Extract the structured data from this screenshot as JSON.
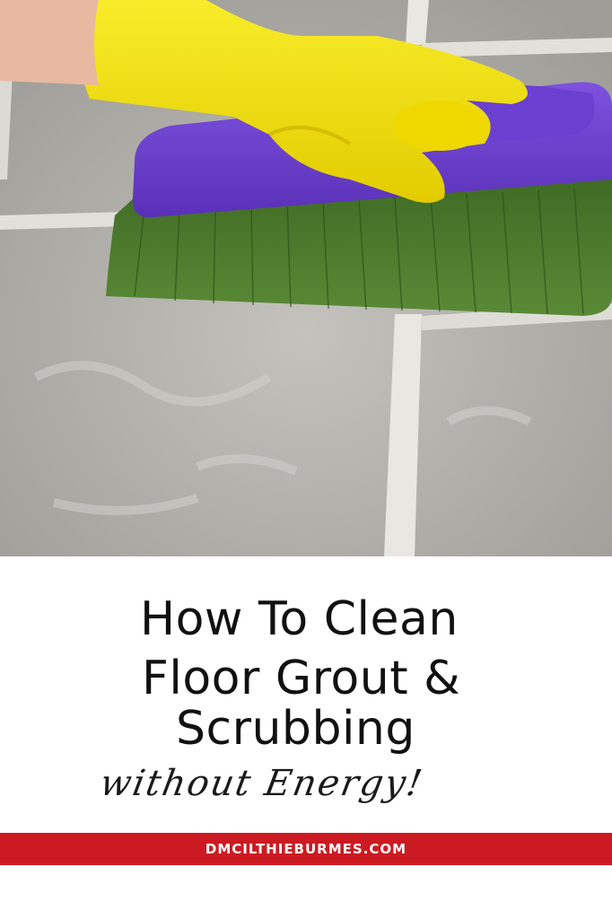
{
  "title": {
    "line1": "How To Clean",
    "line2": "Floor Grout &",
    "line3": "Scrubbing",
    "tagline": "without Energy!"
  },
  "footer": {
    "website": "DMCILTHIEBURMES.COM",
    "band_color": "#cc1a22"
  },
  "image": {
    "subject": "yellow-gloved hand scrubbing tile grout with purple-handled green brush",
    "glove_color": "#f2e10b",
    "brush_handle_color": "#6a3ccc",
    "bristle_color": "#4a7a2c",
    "tile_color": "#b9b7b2",
    "grout_color": "#e8e6e1"
  }
}
